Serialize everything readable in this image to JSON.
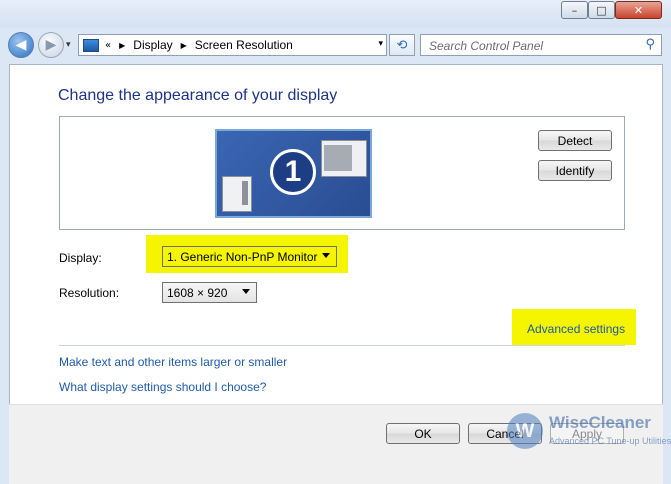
{
  "titlebar": {
    "minimize": "–",
    "maximize": "□",
    "close": "✕"
  },
  "nav": {
    "back": "◀",
    "forward": "▶",
    "recent": "▾"
  },
  "address": {
    "overflow": "«",
    "separator": "▶",
    "crumbs": [
      "Display",
      "Screen Resolution"
    ],
    "dropdown": "▾"
  },
  "refresh": "⟲",
  "search": {
    "placeholder": "Search Control Panel",
    "icon": "⚲"
  },
  "main": {
    "heading": "Change the appearance of your display",
    "monitor_number": "1",
    "detect_label": "Detect",
    "identify_label": "Identify",
    "display_label": "Display:",
    "display_value": "1. Generic Non-PnP Monitor",
    "resolution_label": "Resolution:",
    "resolution_value": "1608 × 920",
    "advanced_link": "Advanced settings",
    "links": [
      "Make text and other items larger or smaller",
      "What display settings should I choose?"
    ]
  },
  "footer": {
    "ok": "OK",
    "cancel": "Cancel",
    "apply": "Apply"
  },
  "watermark": {
    "logo": "W",
    "title": "WiseCleaner",
    "subtitle": "Advanced PC Tune-up Utilities"
  },
  "colors": {
    "highlight": "#f5f500",
    "link": "#1e5aa8",
    "heading": "#1e3287"
  }
}
